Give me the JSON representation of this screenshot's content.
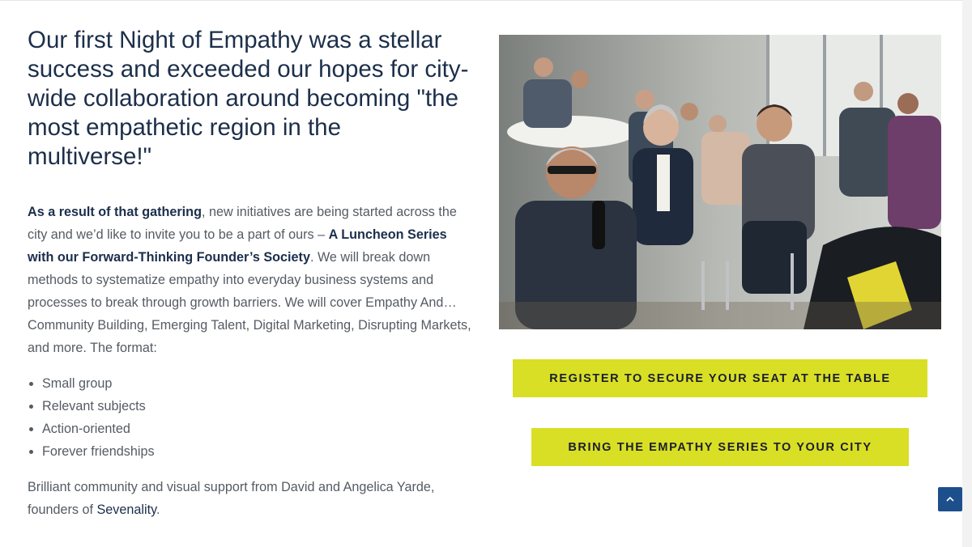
{
  "headline": "Our first Night of Empathy was a stellar success and exceeded our hopes for city-wide collaboration around becoming \"the most empathetic region in the multiverse!\"",
  "intro": {
    "lead_bold": "As a result of that gathering",
    "text1": ", new initiatives are being started across the city and we’d like to invite you to be a part of ours – ",
    "series_bold": "A Luncheon Series with our Forward-Thinking Founder’s Society",
    "text2": ". We will break down methods to systematize empathy into everyday business systems and processes to break through growth barriers. We will cover Empathy And… Community Building, Emerging Talent, Digital Marketing, Disrupting Markets, and more. The format:"
  },
  "format_items": [
    "Small group",
    "Relevant subjects",
    "Action-oriented",
    "Forever friendships"
  ],
  "credit": {
    "text": "Brilliant community and visual support from David and Angelica Yarde, founders of ",
    "link": "Sevenality",
    "end": "."
  },
  "buttons": {
    "register": "REGISTER TO SECURE YOUR SEAT AT THE TABLE",
    "bring": "BRING THE EMPATHY SERIES TO YOUR CITY"
  },
  "icons": {
    "back_to_top": "chevron-up-icon",
    "photo": "event-photo"
  },
  "colors": {
    "accent": "#d9df24",
    "heading": "#1c2f4a",
    "body": "#555b63",
    "back_to_top": "#1d4f8c"
  }
}
